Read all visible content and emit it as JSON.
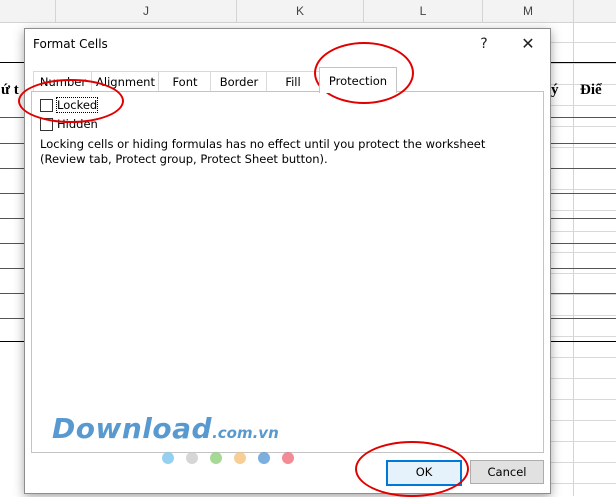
{
  "spreadsheet": {
    "columns": [
      "J",
      "K",
      "L",
      "M"
    ],
    "partial_header_left": "ứ t",
    "partial_header_right_a": "ý",
    "partial_header_right_b": "Điể"
  },
  "dialog": {
    "title": "Format Cells",
    "help_label": "?",
    "close_label": "✕",
    "tabs": [
      {
        "label": "Number",
        "active": false
      },
      {
        "label": "Alignment",
        "active": false
      },
      {
        "label": "Font",
        "active": false
      },
      {
        "label": "Border",
        "active": false
      },
      {
        "label": "Fill",
        "active": false
      },
      {
        "label": "Protection",
        "active": true
      }
    ],
    "protection": {
      "locked": {
        "label": "Locked",
        "checked": false
      },
      "hidden": {
        "label": "Hidden",
        "checked": false
      },
      "description": "Locking cells or hiding formulas has no effect until you protect the worksheet (Review tab, Protect group, Protect Sheet button)."
    },
    "buttons": {
      "ok_label": "OK",
      "cancel_label": "Cancel"
    }
  },
  "watermark": {
    "main": "Download",
    "suffix": ".com.vn",
    "dot_colors": [
      "#7cc4ec",
      "#cccccc",
      "#8fd07a",
      "#f5c27a",
      "#5b9bd5",
      "#ef6e7a"
    ]
  },
  "annotation_color": "#e00000"
}
